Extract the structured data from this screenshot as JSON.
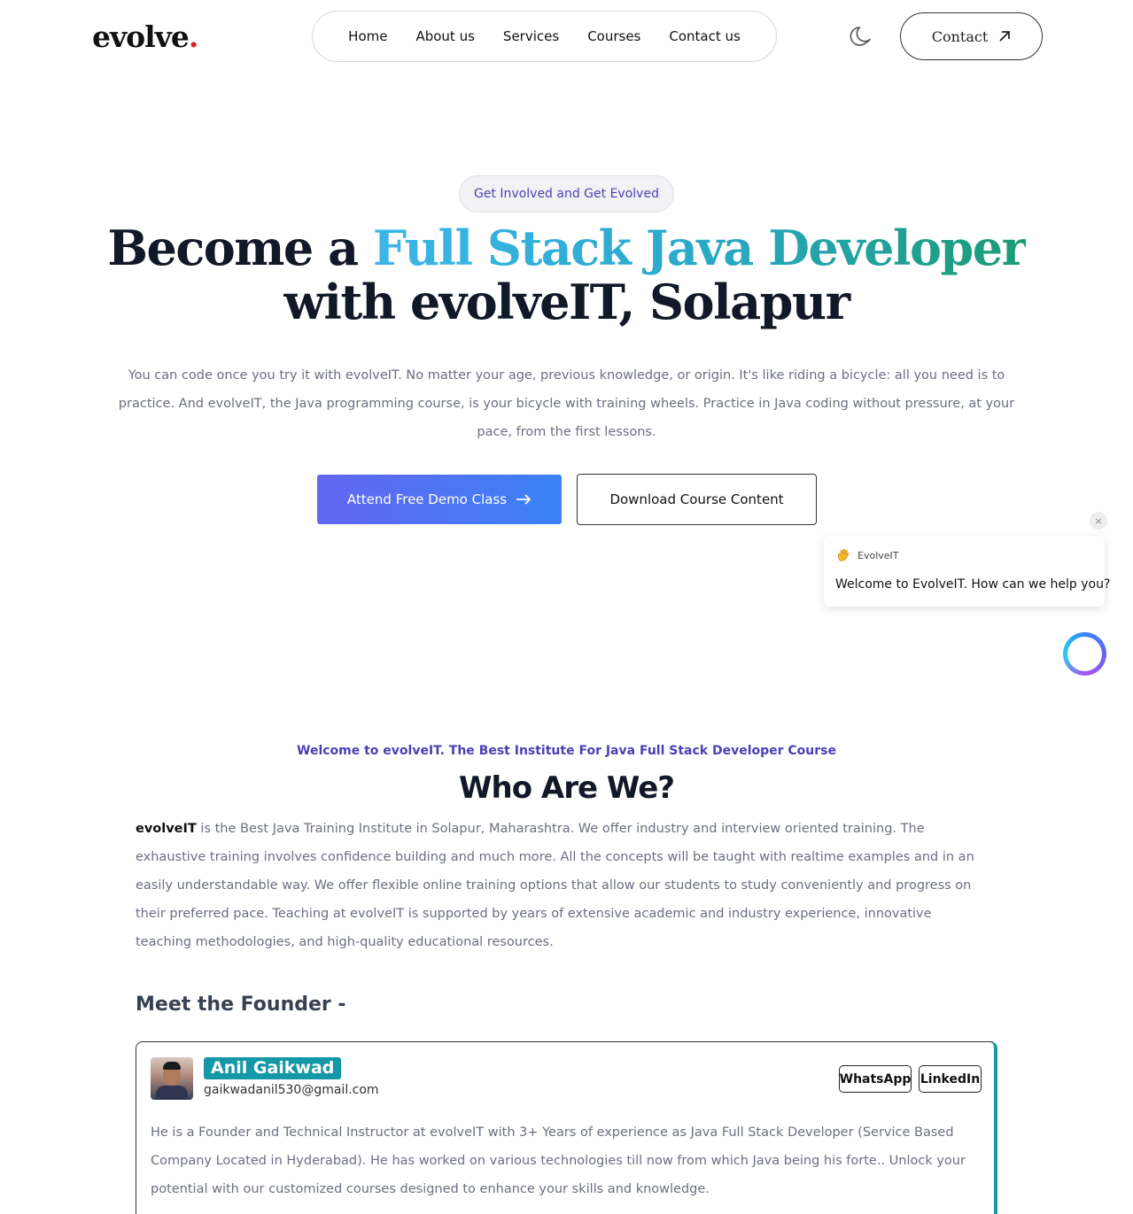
{
  "header": {
    "logo_text": "evolve",
    "logo_dot": ".",
    "nav": [
      "Home",
      "About us",
      "Services",
      "Courses",
      "Contact us"
    ],
    "theme_icon": "moon-icon",
    "contact_label": "Contact",
    "contact_icon": "arrow-up-right-icon"
  },
  "hero": {
    "badge": "Get Involved and Get Evolved",
    "title_prefix": "Become a ",
    "title_highlight": "Full Stack Java Developer",
    "title_line2": "with evolveIT, Solapur",
    "description": "You can code once you try it with evolveIT. No matter your age, previous knowledge, or origin. It's like riding a bicycle: all you need is to practice. And evolveIT, the Java programming course, is your bicycle with training wheels. Practice in Java coding without pressure, at your pace, from the first lessons.",
    "primary_button": "Attend Free Demo Class",
    "secondary_button": "Download Course Content"
  },
  "chat": {
    "close_label": "×",
    "sender": "EvolveIT",
    "message": "Welcome to EvolveIT. How can we help you?"
  },
  "about": {
    "welcome": "Welcome to evolveIT. The Best Institute For Java Full Stack Developer Course",
    "title": "Who Are We?",
    "brand": "evolveIT",
    "text": " is the Best Java Training Institute in Solapur, Maharashtra. We offer industry and interview oriented training. The exhaustive training involves confidence building and much more. All the concepts will be taught with realtime examples and in an easily understandable way. We offer flexible online training options that allow our students to study conveniently and progress on their preferred pace. Teaching at evolveIT is supported by years of extensive academic and industry experience, innovative teaching methodologies, and high-quality educational resources."
  },
  "founder": {
    "heading": "Meet the Founder -",
    "name": "Anil Gaikwad",
    "email": "gaikwadanil530@gmail.com",
    "whatsapp": "WhatsApp",
    "linkedin": "LinkedIn",
    "description": "He is a Founder and Technical Instructor at evolveIT with 3+ Years of experience as Java Full Stack Developer (Service Based Company Located in Hyderabad). He has worked on various technologies till now from which Java being his forte.. Unlock your potential with our customized courses designed to enhance your skills and knowledge."
  },
  "colors": {
    "accent_purple": "#4b3fb5",
    "button_gradient_start": "#6366f1",
    "button_gradient_end": "#3b82f6",
    "founder_teal": "#1497a6",
    "logo_dot_red": "#e11d2a"
  }
}
